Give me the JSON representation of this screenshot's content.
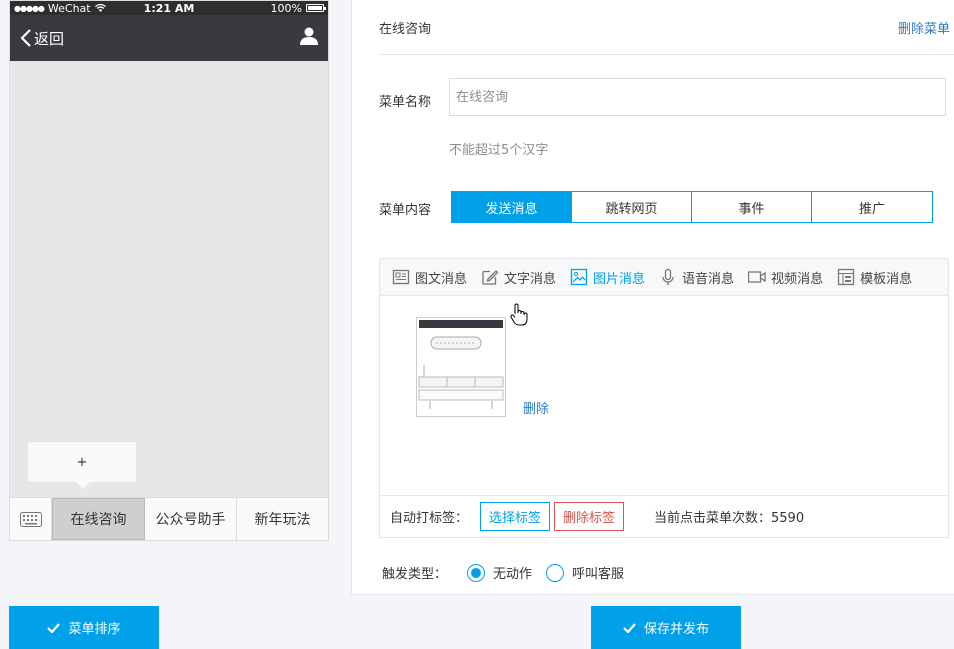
{
  "phone": {
    "status": {
      "carrier": "WeChat",
      "time": "1:21 AM",
      "battery": "100%"
    },
    "nav": {
      "back_label": "返回"
    },
    "sub_menu": {
      "add_label": "+"
    },
    "menu_items": [
      {
        "label": "在线咨询",
        "active": true
      },
      {
        "label": "公众号助手",
        "active": false
      },
      {
        "label": "新年玩法",
        "active": false
      }
    ]
  },
  "editor": {
    "header_title": "在线咨询",
    "delete_menu_label": "删除菜单",
    "name_label": "菜单名称",
    "name_value": "",
    "name_placeholder": "在线咨询",
    "name_hint": "不能超过5个汉字",
    "content_label": "菜单内容",
    "content_options": [
      {
        "label": "发送消息",
        "selected": true
      },
      {
        "label": "跳转网页",
        "selected": false
      },
      {
        "label": "事件",
        "selected": false
      },
      {
        "label": "推广",
        "selected": false
      }
    ],
    "message_tabs": [
      {
        "label": "图文消息",
        "icon": "news-icon",
        "active": false
      },
      {
        "label": "文字消息",
        "icon": "pencil-icon",
        "active": false
      },
      {
        "label": "图片消息",
        "icon": "image-icon",
        "active": true
      },
      {
        "label": "语音消息",
        "icon": "microphone-icon",
        "active": false
      },
      {
        "label": "视频消息",
        "icon": "video-icon",
        "active": false
      },
      {
        "label": "模板消息",
        "icon": "template-icon",
        "active": false
      }
    ],
    "image_delete_label": "删除",
    "auto_tag_label": "自动打标签：",
    "select_tag_label": "选择标签",
    "delete_tag_label": "删除标签",
    "click_count_text": "当前点击菜单次数：5590",
    "trigger_label": "触发类型：",
    "trigger_options": [
      {
        "label": "无动作",
        "selected": true
      },
      {
        "label": "呼叫客服",
        "selected": false
      }
    ]
  },
  "footer": {
    "sort_button_label": "菜单排序",
    "save_button_label": "保存并发布"
  },
  "colors": {
    "accent": "#00a1e9",
    "link": "#2d79c7",
    "danger": "#d9534f",
    "nav_bg": "#393a3f"
  }
}
